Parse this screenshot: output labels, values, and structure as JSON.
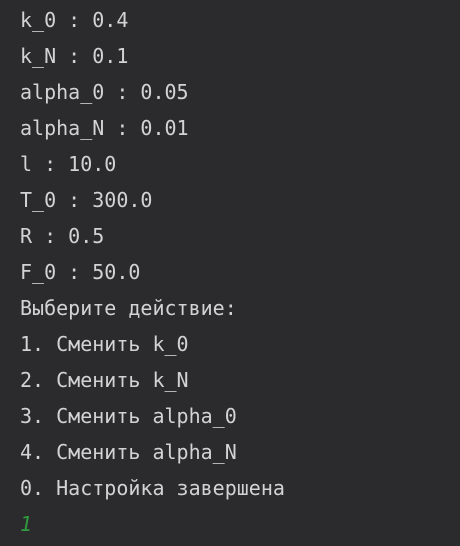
{
  "terminal": {
    "lines": [
      "k_0 : 0.4",
      "k_N : 0.1",
      "alpha_0 : 0.05",
      "alpha_N : 0.01",
      "l : 10.0",
      "T_0 : 300.0",
      "R : 0.5",
      "F_0 : 50.0",
      "Выберите действие:",
      "1. Сменить k_0",
      "2. Сменить k_N",
      "3. Сменить alpha_0",
      "4. Сменить alpha_N",
      "0. Настройка завершена"
    ],
    "user_input": "1",
    "colors": {
      "background": "#2b2b2d",
      "text": "#d3d3d3",
      "user_input": "#2f9a3e"
    }
  }
}
